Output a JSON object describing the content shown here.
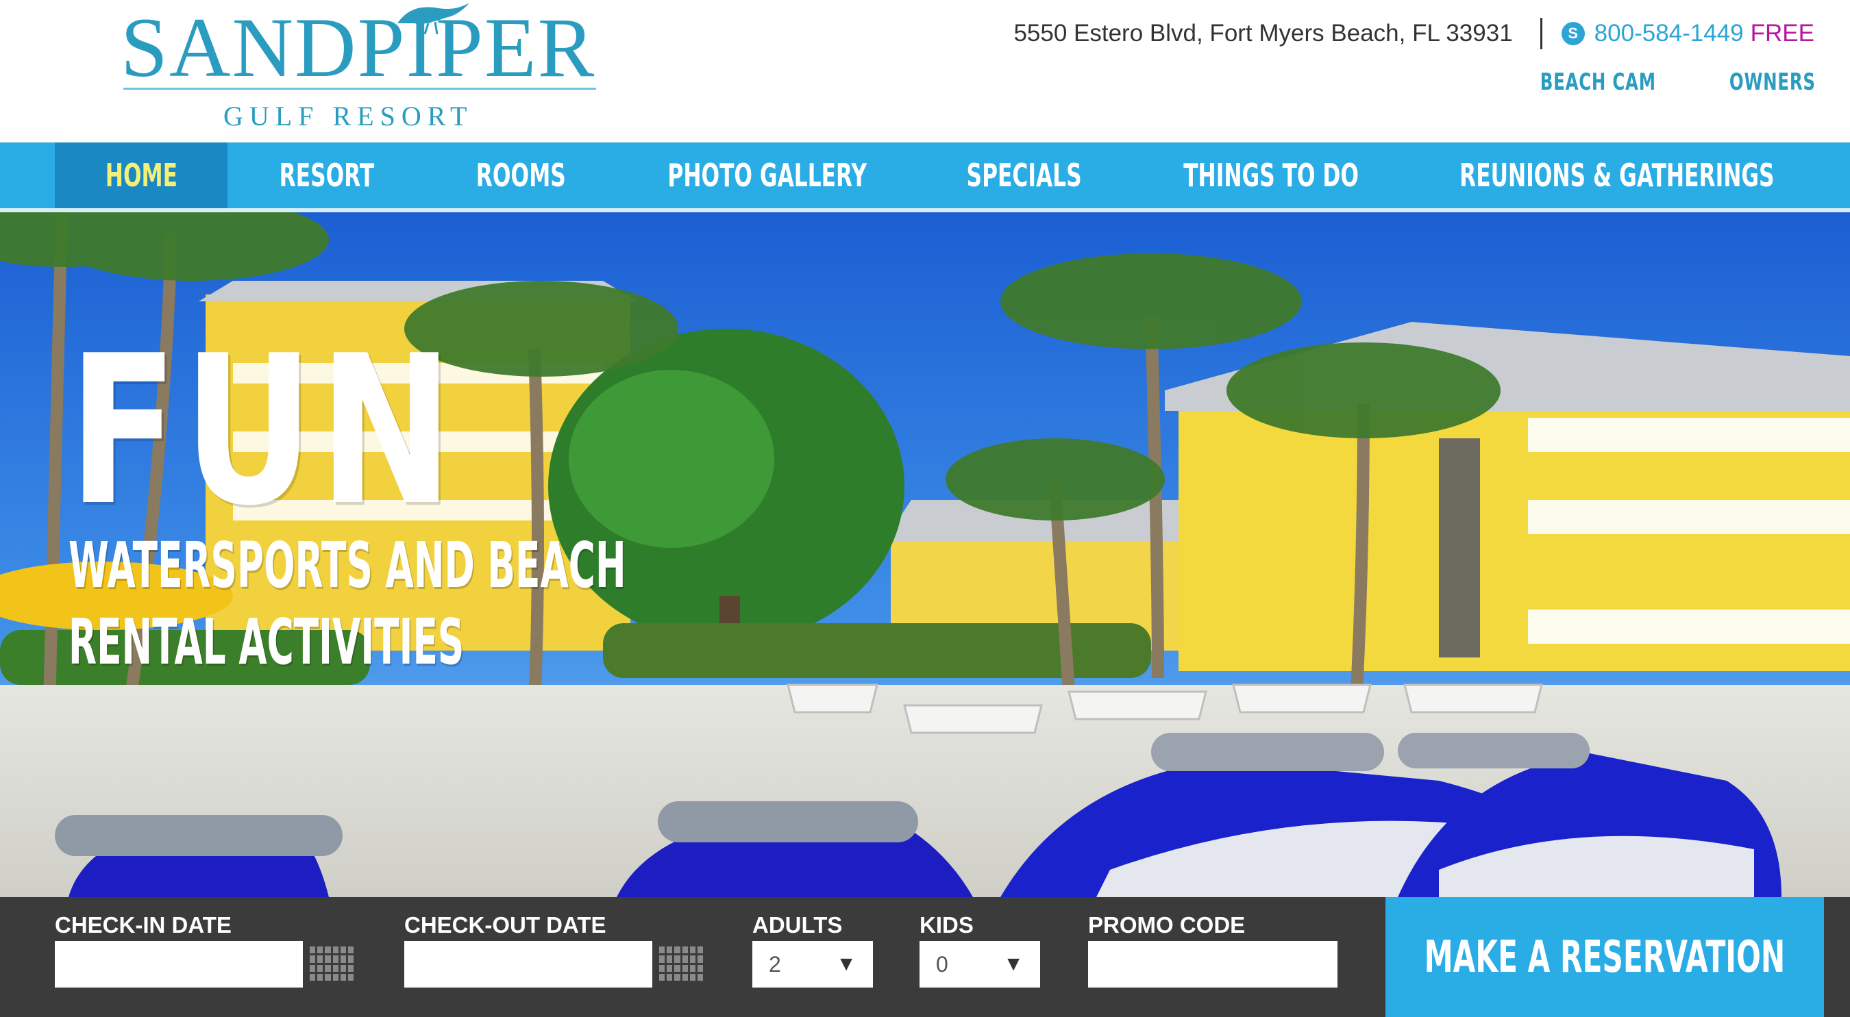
{
  "header": {
    "logo_main": "SANDPIPER",
    "logo_sub": "GULF RESORT",
    "address": "5550 Estero Blvd, Fort Myers Beach, FL 33931",
    "phone": "800-584-1449",
    "phone_free": "FREE",
    "links": [
      "BEACH CAM",
      "OWNERS"
    ]
  },
  "nav": {
    "items": [
      {
        "label": "HOME",
        "active": true
      },
      {
        "label": "RESORT"
      },
      {
        "label": "ROOMS"
      },
      {
        "label": "PHOTO GALLERY"
      },
      {
        "label": "SPECIALS"
      },
      {
        "label": "THINGS TO DO"
      },
      {
        "label": "REUNIONS & GATHERINGS"
      }
    ]
  },
  "hero": {
    "headline": "FUN",
    "subline": "WATERSPORTS AND BEACH RENTAL ACTIVITIES"
  },
  "booking": {
    "checkin_label": "CHECK-IN DATE",
    "checkin_value": "",
    "checkout_label": "CHECK-OUT DATE",
    "checkout_value": "",
    "adults_label": "ADULTS",
    "adults_value": "2",
    "kids_label": "KIDS",
    "kids_value": "0",
    "promo_label": "PROMO CODE",
    "promo_value": "",
    "reserve_label": "MAKE A RESERVATION"
  },
  "colors": {
    "brand_blue": "#2aace5",
    "nav_active": "#1a88c2",
    "nav_active_text": "#f3ef78",
    "free_text": "#b5179e",
    "booking_bar": "#3b3b3b"
  }
}
